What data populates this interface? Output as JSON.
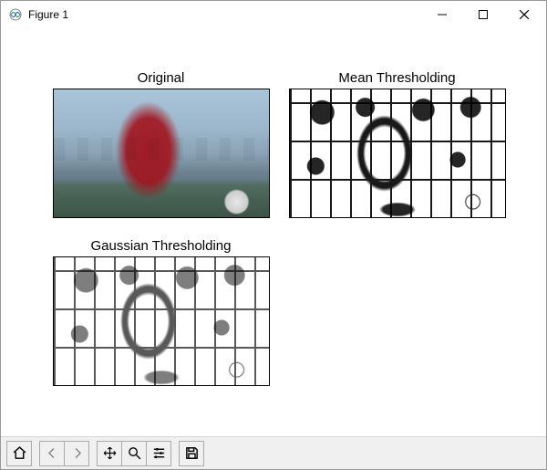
{
  "window": {
    "title": "Figure 1"
  },
  "subplots": [
    {
      "title": "Original"
    },
    {
      "title": "Mean Thresholding"
    },
    {
      "title": "Gaussian Thresholding"
    }
  ],
  "toolbar": {
    "buttons": [
      {
        "name": "home-icon"
      },
      {
        "name": "back-icon"
      },
      {
        "name": "forward-icon"
      },
      {
        "name": "pan-icon"
      },
      {
        "name": "zoom-icon"
      },
      {
        "name": "configure-icon"
      },
      {
        "name": "save-icon"
      }
    ]
  }
}
